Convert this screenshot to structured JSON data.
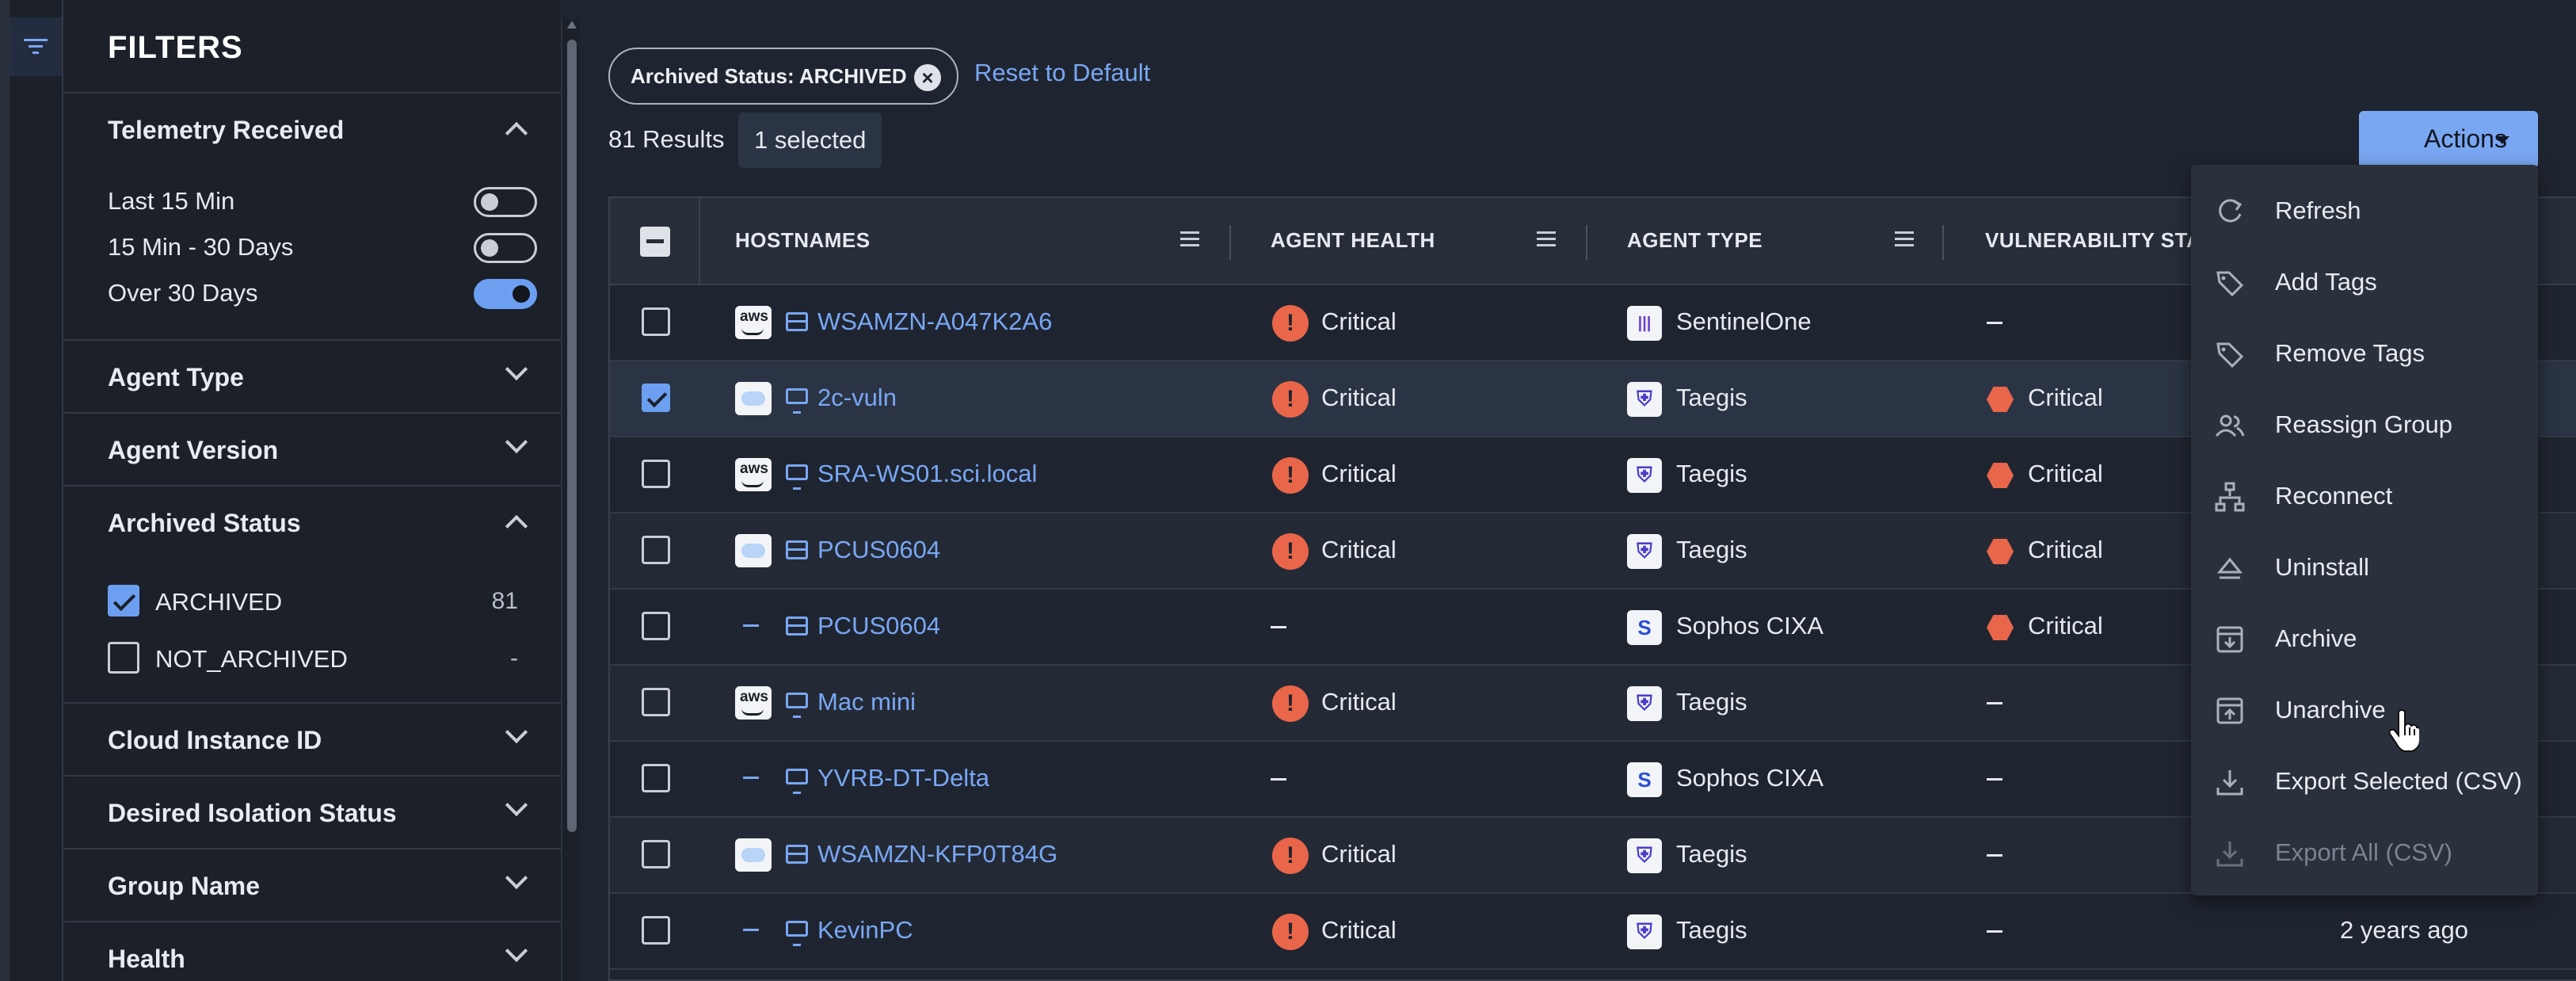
{
  "filters": {
    "title": "FILTERS",
    "sections": {
      "telemetry": {
        "label": "Telemetry Received",
        "options": [
          {
            "label": "Last 15 Min",
            "on": false
          },
          {
            "label": "15 Min - 30 Days",
            "on": false
          },
          {
            "label": "Over 30 Days",
            "on": true
          }
        ]
      },
      "agent_type": {
        "label": "Agent Type"
      },
      "agent_version": {
        "label": "Agent Version"
      },
      "archived_status": {
        "label": "Archived Status",
        "options": [
          {
            "label": "ARCHIVED",
            "count": "81",
            "checked": true
          },
          {
            "label": "NOT_ARCHIVED",
            "count": "-",
            "checked": false
          }
        ]
      },
      "cloud_instance": {
        "label": "Cloud Instance ID"
      },
      "desired_isolation": {
        "label": "Desired Isolation Status"
      },
      "group_name": {
        "label": "Group Name"
      },
      "health": {
        "label": "Health"
      }
    }
  },
  "toolbar": {
    "chip_label": "Archived Status: ARCHIVED",
    "reset_label": "Reset to Default",
    "results": "81 Results",
    "selected": "1 selected",
    "actions_label": "Actions"
  },
  "table": {
    "columns": [
      "HOSTNAMES",
      "AGENT HEALTH",
      "AGENT TYPE",
      "VULNERABILITY STA"
    ],
    "rows": [
      {
        "hostname": "WSAMZN-A047K2A6",
        "cloud": "aws",
        "device": "server",
        "health": "Critical",
        "agent": "SentinelOne",
        "agent_icon": "sentinelone-icon",
        "vuln": "",
        "time": "",
        "checked": false
      },
      {
        "hostname": "2c-vuln",
        "cloud": "blue",
        "device": "desktop",
        "health": "Critical",
        "agent": "Taegis",
        "agent_icon": "taegis-icon",
        "vuln": "Critical",
        "time": "",
        "checked": true
      },
      {
        "hostname": "SRA-WS01.sci.local",
        "cloud": "aws",
        "device": "desktop",
        "health": "Critical",
        "agent": "Taegis",
        "agent_icon": "taegis-icon",
        "vuln": "Critical",
        "time": "",
        "checked": false
      },
      {
        "hostname": "PCUS0604",
        "cloud": "blue",
        "device": "server",
        "health": "Critical",
        "agent": "Taegis",
        "agent_icon": "taegis-icon",
        "vuln": "Critical",
        "time": "",
        "checked": false
      },
      {
        "hostname": "PCUS0604",
        "cloud": "none",
        "device": "server",
        "health": "",
        "agent": "Sophos CIXA",
        "agent_icon": "sophos-icon",
        "vuln": "Critical",
        "time": "",
        "checked": false
      },
      {
        "hostname": "Mac mini",
        "cloud": "aws",
        "device": "desktop",
        "health": "Critical",
        "agent": "Taegis",
        "agent_icon": "taegis-icon",
        "vuln": "",
        "time": "",
        "checked": false
      },
      {
        "hostname": "YVRB-DT-Delta",
        "cloud": "none",
        "device": "desktop",
        "health": "",
        "agent": "Sophos CIXA",
        "agent_icon": "sophos-icon",
        "vuln": "",
        "time": "",
        "checked": false
      },
      {
        "hostname": "WSAMZN-KFP0T84G",
        "cloud": "blue",
        "device": "server",
        "health": "Critical",
        "agent": "Taegis",
        "agent_icon": "taegis-icon",
        "vuln": "",
        "time": "",
        "checked": false
      },
      {
        "hostname": "KevinPC",
        "cloud": "none",
        "device": "desktop",
        "health": "Critical",
        "agent": "Taegis",
        "agent_icon": "taegis-icon",
        "vuln": "",
        "time": "2 years ago",
        "checked": false
      }
    ]
  },
  "actions_menu": {
    "items": [
      {
        "label": "Refresh",
        "icon": "refresh-icon",
        "disabled": false
      },
      {
        "label": "Add Tags",
        "icon": "tag-icon",
        "disabled": false
      },
      {
        "label": "Remove Tags",
        "icon": "tag-icon",
        "disabled": false
      },
      {
        "label": "Reassign Group",
        "icon": "users-icon",
        "disabled": false
      },
      {
        "label": "Reconnect",
        "icon": "network-icon",
        "disabled": false
      },
      {
        "label": "Uninstall",
        "icon": "eject-icon",
        "disabled": false
      },
      {
        "label": "Archive",
        "icon": "archive-icon",
        "disabled": false
      },
      {
        "label": "Unarchive",
        "icon": "unarchive-icon",
        "disabled": false
      },
      {
        "label": "Export Selected (CSV)",
        "icon": "download-icon",
        "disabled": false
      },
      {
        "label": "Export All (CSV)",
        "icon": "download-icon",
        "disabled": true
      }
    ]
  },
  "colors": {
    "accent": "#7aa7f2",
    "critical": "#e9664a",
    "background": "#1f2530",
    "panel": "#1b2029"
  }
}
